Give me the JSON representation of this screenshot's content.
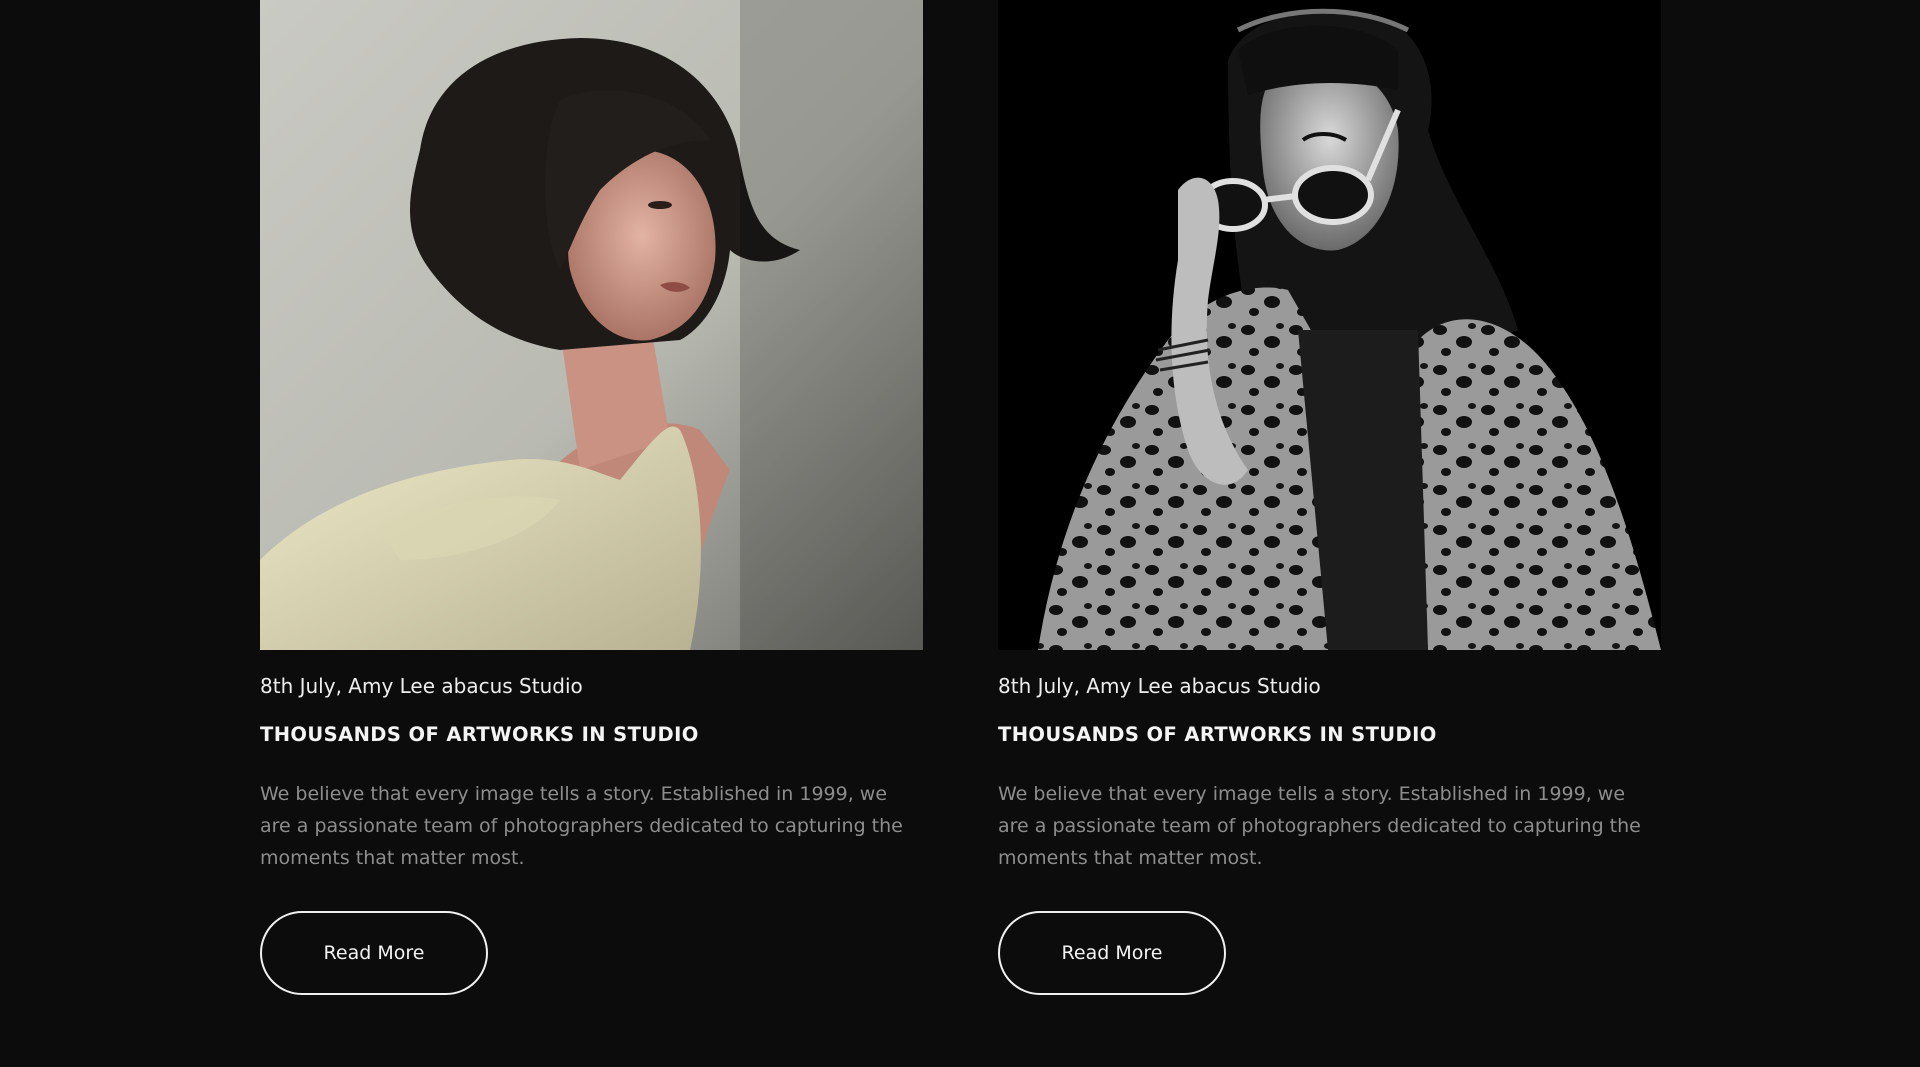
{
  "cards": [
    {
      "meta": "8th July, Amy Lee abacus Studio",
      "title": "THOUSANDS OF ARTWORKS IN STUDIO",
      "description": "We believe that every image tells a story. Established in 1999, we are a passionate team of photographers dedicated to capturing the moments that matter most.",
      "button_label": "Read More"
    },
    {
      "meta": "8th July, Amy Lee abacus Studio",
      "title": "THOUSANDS OF ARTWORKS IN STUDIO",
      "description": "We believe that every image tells a story. Established in 1999, we are a passionate team of photographers dedicated to capturing the moments that matter most.",
      "button_label": "Read More"
    }
  ],
  "colors": {
    "background": "#0c0c0c",
    "button_border": "#f0f0f0",
    "description_text": "#8d8d8d"
  }
}
